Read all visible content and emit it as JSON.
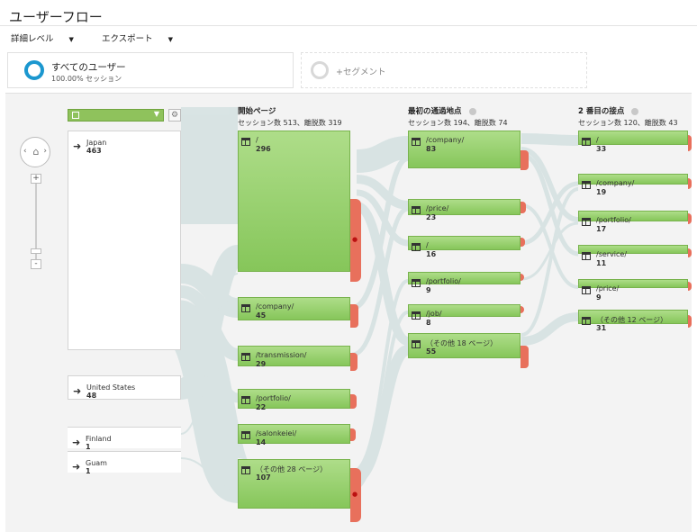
{
  "header": {
    "title": "ユーザーフロー",
    "menu": [
      {
        "label": "詳細レベル"
      },
      {
        "label": "エクスポート"
      }
    ]
  },
  "segments": {
    "primary": {
      "name": "すべてのユーザー",
      "sub": "100.00% セッション"
    },
    "add_label": "+セグメント"
  },
  "colors": {
    "node_green": "#8fc25c",
    "drop_red": "#e8705c",
    "ring_blue": "#1b97cf",
    "flow": "#d7e3e3"
  },
  "icons": {
    "zoom_in": "+",
    "zoom_out": "-",
    "home": "⌂",
    "gear": "⚙"
  },
  "columns": [
    {
      "title": "開始ページ",
      "stats": "セッション数 513、離脱数 319"
    },
    {
      "title": "最初の通過地点",
      "stats": "セッション数 194、離脱数 74"
    },
    {
      "title": "2 番目の接点",
      "stats": "セッション数 120、離脱数 43"
    }
  ],
  "countries": [
    {
      "name": "Japan",
      "count": "463"
    },
    {
      "name": "United States",
      "count": "48"
    },
    {
      "name": "Finland",
      "count": "1"
    },
    {
      "name": "Guam",
      "count": "1"
    }
  ],
  "start_pages": [
    {
      "name": "/",
      "count": "296"
    },
    {
      "name": "/company/",
      "count": "45"
    },
    {
      "name": "/transmission/",
      "count": "29"
    },
    {
      "name": "/portfolio/",
      "count": "22"
    },
    {
      "name": "/salonkeiei/",
      "count": "14"
    },
    {
      "name": "（その他 28 ページ）",
      "count": "107"
    }
  ],
  "first_interaction": [
    {
      "name": "/company/",
      "count": "83"
    },
    {
      "name": "/price/",
      "count": "23"
    },
    {
      "name": "/",
      "count": "16"
    },
    {
      "name": "/portfolio/",
      "count": "9"
    },
    {
      "name": "/job/",
      "count": "8"
    },
    {
      "name": "（その他 18 ページ）",
      "count": "55"
    }
  ],
  "second_interaction": [
    {
      "name": "/",
      "count": "33"
    },
    {
      "name": "/company/",
      "count": "19"
    },
    {
      "name": "/portfolio/",
      "count": "17"
    },
    {
      "name": "/service/",
      "count": "11"
    },
    {
      "name": "/price/",
      "count": "9"
    },
    {
      "name": "（その他 12 ページ）",
      "count": "31"
    }
  ]
}
